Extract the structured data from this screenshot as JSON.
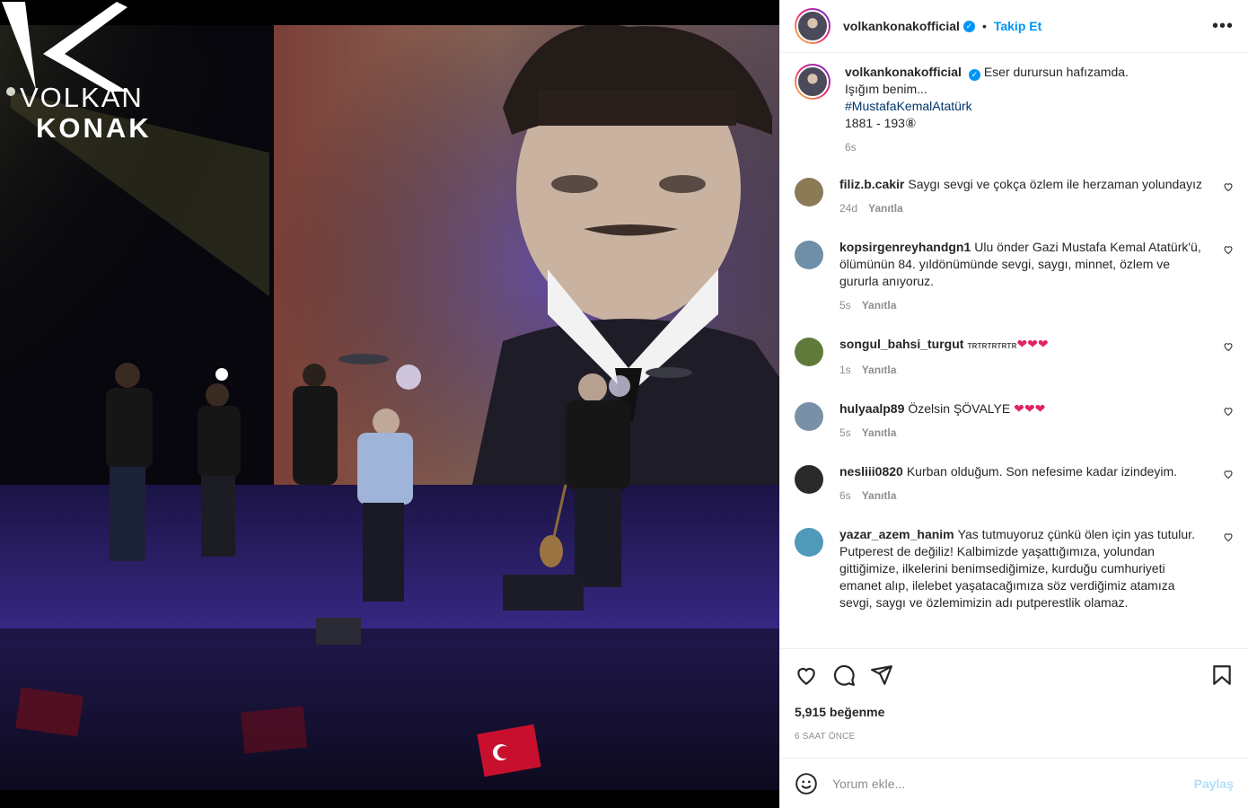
{
  "photo": {
    "logo_line1": "VOLKAN",
    "logo_line2": "KONAK"
  },
  "post": {
    "username": "volkankonakofficial",
    "follow_label": "Takip Et",
    "more_label": "•••"
  },
  "caption": {
    "username": "volkankonakofficial",
    "lines": [
      "Eser durursun hafızamda.",
      "Işığım benim..."
    ],
    "hashtag": "#MustafaKemalAtatürk",
    "years": "1881 - 193⑧",
    "time": "6s"
  },
  "comments": [
    {
      "username": "filiz.b.cakir",
      "text": "Saygı sevgi ve çokça özlem ile herzaman yolundayız",
      "time": "24d",
      "reply": "Yanıtla",
      "avatar": "#8a7a55"
    },
    {
      "username": "kopsirgenreyhandgn1",
      "text": "Ulu önder Gazi Mustafa Kemal Atatürk'ü, ölümünün 84. yıldönümünde sevgi, saygı, minnet, özlem ve gururla anıyoruz.",
      "time": "5s",
      "reply": "Yanıtla",
      "avatar": "#6f8fa8"
    },
    {
      "username": "songul_bahsi_turgut",
      "text": "ᴛʀᴛʀᴛʀᴛʀᴛʀ",
      "hearts": "❤❤❤",
      "time": "1s",
      "reply": "Yanıtla",
      "avatar": "#5f7a3a"
    },
    {
      "username": "hulyaalp89",
      "text": "Özelsin ŞÖVALYE",
      "hearts": "❤❤❤",
      "time": "5s",
      "reply": "Yanıtla",
      "avatar": "#7890a8"
    },
    {
      "username": "nesliii0820",
      "text": "Kurban olduğum. Son nefesime kadar izindeyim.",
      "time": "6s",
      "reply": "Yanıtla",
      "avatar": "#2a2a2a"
    },
    {
      "username": "yazar_azem_hanim",
      "text": "Yas tutmuyoruz çünkü ölen için yas tutulur. Putperest de değiliz! Kalbimizde yaşattığımıza, yolundan gittiğimize, ilkelerini benimsediğimize, kurduğu cumhuriyeti emanet alıp, ilelebet yaşatacağımıza söz verdiğimiz atamıza sevgi, saygı ve özlemimizin adı putperestlik olamaz.",
      "avatar": "#4f9ab8"
    }
  ],
  "actions": {
    "likes": "5,915 beğenme",
    "time": "6 SAAT ÖNCE"
  },
  "add_comment": {
    "placeholder": "Yorum ekle...",
    "share_label": "Paylaş"
  }
}
